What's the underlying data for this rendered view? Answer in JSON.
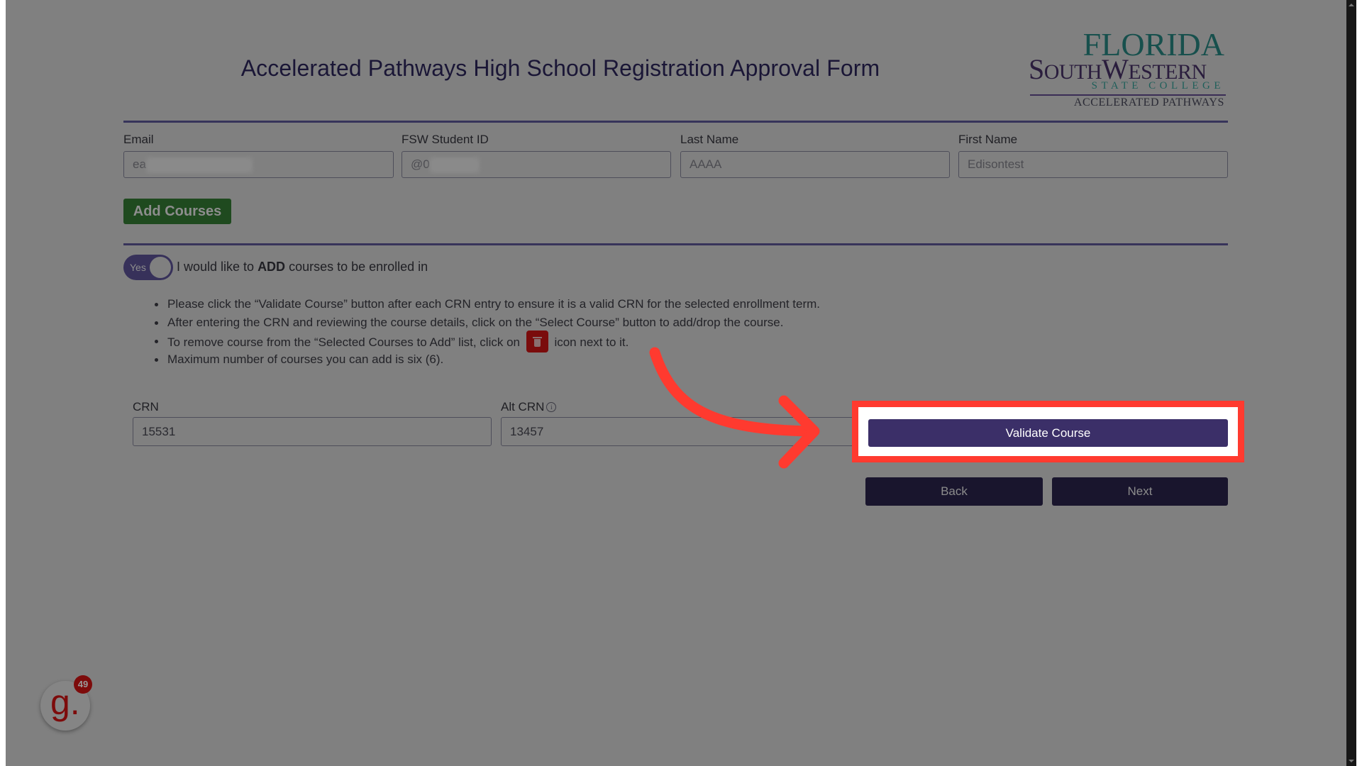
{
  "header": {
    "title": "Accelerated Pathways High School Registration Approval Form",
    "logo": {
      "line1": "FLORIDA",
      "line2": "SouthWestern",
      "line3": "STATE COLLEGE",
      "line4": "ACCELERATED PATHWAYS"
    }
  },
  "student": {
    "email": {
      "label": "Email",
      "value": "ea"
    },
    "student_id": {
      "label": "FSW Student ID",
      "value": "@0"
    },
    "last_name": {
      "label": "Last Name",
      "value": "AAAA"
    },
    "first_name": {
      "label": "First Name",
      "value": "Edisontest"
    }
  },
  "add_courses_button": "Add Courses",
  "toggle": {
    "state_label": "Yes",
    "on": true,
    "text_prefix": "I would like to ",
    "text_bold": "ADD",
    "text_suffix": " courses to be enrolled in"
  },
  "instructions": [
    "Please click the “Validate Course” button after each CRN entry to ensure it is a valid CRN for the selected enrollment term.",
    "After entering the CRN and reviewing the course details, click on the “Select Course” button to add/drop the course.",
    {
      "before": "To remove course from the “Selected Courses to Add” list, click on",
      "icon": "trash-icon",
      "after": "icon next to it."
    },
    "Maximum number of courses you can add is six (6)."
  ],
  "course_entry": {
    "crn": {
      "label": "CRN",
      "value": "15531"
    },
    "alt_crn": {
      "label": "Alt CRN",
      "value": "13457",
      "info_icon": "info-icon"
    }
  },
  "buttons": {
    "validate": "Validate Course",
    "back": "Back",
    "next": "Next"
  },
  "annotation": {
    "highlight_color": "#ff3a2f",
    "arrow_color": "#ff3a2f",
    "target": "Validate Course"
  },
  "grammarly": {
    "glyph": "g.",
    "count": "49"
  },
  "colors": {
    "overlay_gray": "#808080",
    "primary_purple": "#3b2f68",
    "add_green": "#1f4a1f",
    "nav_dark": "#19152d",
    "trash_red": "#7a0c0c"
  }
}
